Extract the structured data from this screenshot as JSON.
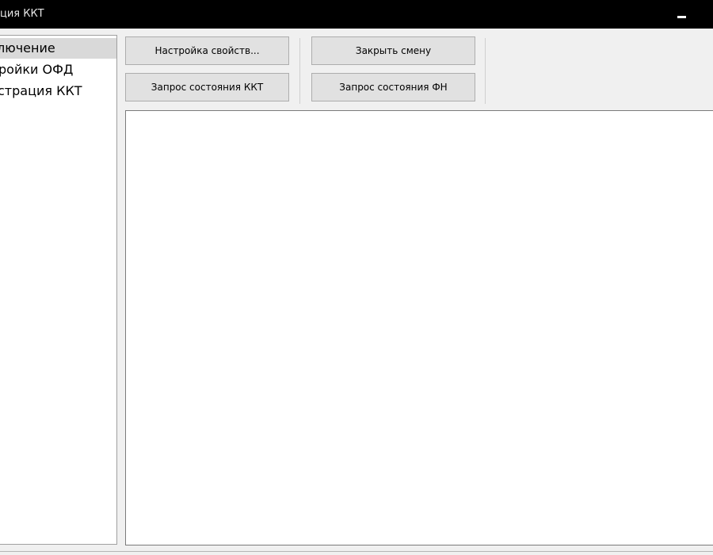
{
  "window": {
    "title": "ация ККТ",
    "minimize_icon": "minimize-icon"
  },
  "sidebar": {
    "items": [
      {
        "label": "лючение",
        "selected": true
      },
      {
        "label": "ройки ОФД",
        "selected": false
      },
      {
        "label": "страция ККТ",
        "selected": false
      }
    ]
  },
  "toolbar": {
    "properties_label": "Настройка свойств...",
    "kkt_status_label": "Запрос состояния ККТ",
    "close_shift_label": "Закрыть смену",
    "fn_status_label": "Запрос состояния ФН"
  },
  "colors": {
    "titlebar_bg": "#000000",
    "window_bg": "#f0f0f0",
    "selected_item_bg": "#d9d9d9",
    "panel_bg": "#ffffff"
  }
}
